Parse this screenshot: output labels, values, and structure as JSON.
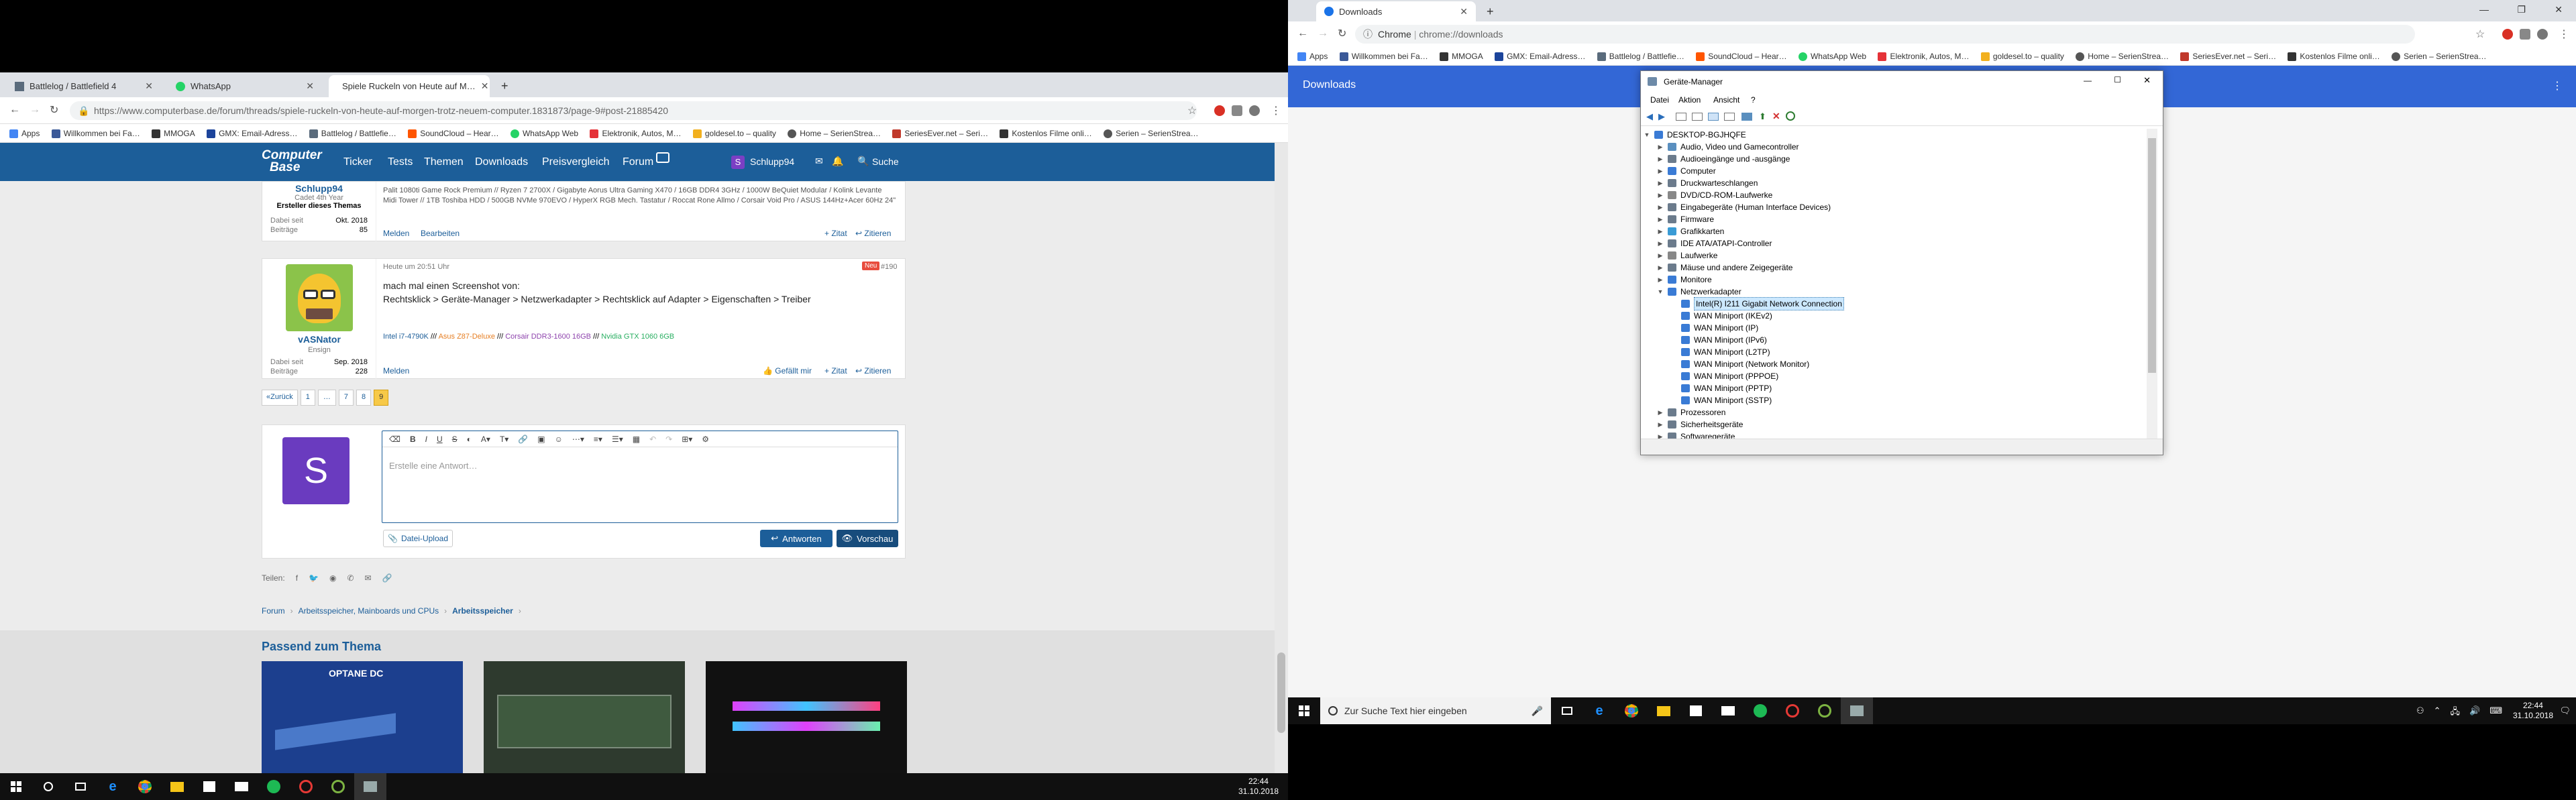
{
  "left_browser": {
    "tabs": [
      {
        "label": "Battlelog / Battlefield 4",
        "color": "#5a6b7c"
      },
      {
        "label": "WhatsApp",
        "color": "#25d366"
      },
      {
        "label": "Spiele Ruckeln von Heute auf M…",
        "color": "#1c5e99"
      }
    ],
    "new_tab": "+",
    "url": "https://www.computerbase.de/forum/threads/spiele-ruckeln-von-heute-auf-morgen-trotz-neuem-computer.1831873/page-9#post-21885420",
    "bookmarks": [
      {
        "label": "Apps",
        "color": "#4285f4"
      },
      {
        "label": "Willkommen bei Fa…",
        "color": "#3b5998"
      },
      {
        "label": "MMOGA",
        "color": "#333333"
      },
      {
        "label": "GMX: Email-Adress…",
        "color": "#1c449b"
      },
      {
        "label": "Battlelog / Battlefie…",
        "color": "#5a6b7c"
      },
      {
        "label": "SoundCloud – Hear…",
        "color": "#ff5500"
      },
      {
        "label": "WhatsApp Web",
        "color": "#25d366"
      },
      {
        "label": "Elektronik, Autos, M…",
        "color": "#e53238"
      },
      {
        "label": "goldesel.to – quality",
        "color": "#f2b01e"
      },
      {
        "label": "Home – SerienStrea…",
        "color": "#555555"
      },
      {
        "label": "SeriesEver.net – Seri…",
        "color": "#c0392b"
      },
      {
        "label": "Kostenlos Filme onli…",
        "color": "#333333"
      },
      {
        "label": "Serien – SerienStrea…",
        "color": "#555555"
      }
    ],
    "site_nav": {
      "logo_line1": "Computer",
      "logo_line2": "Base",
      "items": [
        "Ticker",
        "Tests",
        "Themen",
        "Downloads",
        "Preisvergleich",
        "Forum"
      ],
      "user": "Schlupp94",
      "search": "Suche"
    },
    "post1": {
      "user": "Schlupp94",
      "rank": "Cadet 4th Year",
      "role": "Ersteller dieses Themas",
      "dabei_label": "Dabei seit",
      "dabei": "Okt. 2018",
      "beitraege_label": "Beiträge",
      "beitraege": "85",
      "signature": "Palit 1080ti Game Rock Premium // Ryzen 7 2700X / Gigabyte Aorus Ultra Gaming X470 / 16GB DDR4 3GHz / 1000W BeQuiet Modular / Kolink Levante Midi Tower // 1TB Toshiba HDD / 500GB NVMe 970EVO / HyperX RGB Mech. Tastatur / Roccat Rone Allmo / Corsair Void Pro / ASUS 144Hz+Acer 60Hz 24\"",
      "melden": "Melden",
      "bearbeiten": "Bearbeiten",
      "zitat": "Zitat",
      "zitieren": "Zitieren"
    },
    "post2": {
      "time": "Heute um 20:51 Uhr",
      "badge": "Neu",
      "number": "#190",
      "user": "vASNator",
      "rank": "Ensign",
      "dabei_label": "Dabei seit",
      "dabei": "Sep. 2018",
      "beitraege_label": "Beiträge",
      "beitraege": "228",
      "line1": "mach mal einen Screenshot von:",
      "line2": "Rechtsklick > Geräte-Manager > Netzwerkadapter > Rechtsklick auf Adapter > Eigenschaften > Treiber",
      "sig_parts": [
        {
          "text": "Intel i7-4790K",
          "color": "#1c5e99"
        },
        {
          "text": " /// ",
          "color": "#000000"
        },
        {
          "text": "Asus Z87-Deluxe",
          "color": "#e67e22"
        },
        {
          "text": " /// ",
          "color": "#000000"
        },
        {
          "text": "Corsair DDR3-1600 16GB",
          "color": "#8e44ad"
        },
        {
          "text": " /// ",
          "color": "#000000"
        },
        {
          "text": "Nvidia GTX 1060 6GB",
          "color": "#27ae60"
        }
      ],
      "gefaellt": "Gefällt mir",
      "melden": "Melden",
      "zitat": "Zitat",
      "zitieren": "Zitieren"
    },
    "pagination": [
      "«Zurück",
      "1",
      "…",
      "7",
      "8",
      "9"
    ],
    "editor": {
      "avatar_letter": "S",
      "placeholder": "Erstelle eine Antwort…",
      "upload": "Datei-Upload",
      "antworten": "Antworten",
      "vorschau": "Vorschau"
    },
    "share_label": "Teilen:",
    "breadcrumb": [
      "Forum",
      "Arbeitsspeicher, Mainboards und CPUs",
      "Arbeitsspeicher"
    ],
    "related_title": "Passend zum Thema",
    "related_thumb1_caption": "OPTANE DC",
    "taskbar_time": "22:44",
    "taskbar_date": "31.10.2018"
  },
  "right_browser": {
    "tab": "Downloads",
    "new_tab": "+",
    "omnibox_prefix": "Chrome",
    "omnibox_url": "chrome://downloads",
    "bookmarks": [
      {
        "label": "Apps",
        "color": "#4285f4"
      },
      {
        "label": "Willkommen bei Fa…",
        "color": "#3b5998"
      },
      {
        "label": "MMOGA",
        "color": "#333333"
      },
      {
        "label": "GMX: Email-Adress…",
        "color": "#1c449b"
      },
      {
        "label": "Battlelog / Battlefie…",
        "color": "#5a6b7c"
      },
      {
        "label": "SoundCloud – Hear…",
        "color": "#ff5500"
      },
      {
        "label": "WhatsApp Web",
        "color": "#25d366"
      },
      {
        "label": "Elektronik, Autos, M…",
        "color": "#e53238"
      },
      {
        "label": "goldesel.to – quality",
        "color": "#f2b01e"
      },
      {
        "label": "Home – SerienStrea…",
        "color": "#555555"
      },
      {
        "label": "SeriesEver.net – Seri…",
        "color": "#c0392b"
      },
      {
        "label": "Kostenlos Filme onli…",
        "color": "#333333"
      },
      {
        "label": "Serien – SerienStrea…",
        "color": "#555555"
      }
    ],
    "downloads_title": "Downloads",
    "device_manager": {
      "title": "Geräte-Manager",
      "menu": [
        "Datei",
        "Aktion",
        "Ansicht",
        "?"
      ],
      "nodes": [
        {
          "label": "DESKTOP-BGJHQFE",
          "level": 0,
          "expanded": true,
          "color": "#3a7bd5"
        },
        {
          "label": "Audio, Video und Gamecontroller",
          "level": 1,
          "expanded": false,
          "color": "#5a8fbf"
        },
        {
          "label": "Audioeingänge und -ausgänge",
          "level": 1,
          "expanded": false,
          "color": "#6b7b8c"
        },
        {
          "label": "Computer",
          "level": 1,
          "expanded": false,
          "color": "#3a7bd5"
        },
        {
          "label": "Druckwarteschlangen",
          "level": 1,
          "expanded": false,
          "color": "#6b7b8c"
        },
        {
          "label": "DVD/CD-ROM-Laufwerke",
          "level": 1,
          "expanded": false,
          "color": "#888888"
        },
        {
          "label": "Eingabegeräte (Human Interface Devices)",
          "level": 1,
          "expanded": false,
          "color": "#6b7b8c"
        },
        {
          "label": "Firmware",
          "level": 1,
          "expanded": false,
          "color": "#6b7b8c"
        },
        {
          "label": "Grafikkarten",
          "level": 1,
          "expanded": false,
          "color": "#3a9bd5"
        },
        {
          "label": "IDE ATA/ATAPI-Controller",
          "level": 1,
          "expanded": false,
          "color": "#6b7b8c"
        },
        {
          "label": "Laufwerke",
          "level": 1,
          "expanded": false,
          "color": "#888888"
        },
        {
          "label": "Mäuse und andere Zeigegeräte",
          "level": 1,
          "expanded": false,
          "color": "#6b7b8c"
        },
        {
          "label": "Monitore",
          "level": 1,
          "expanded": false,
          "color": "#3a7bd5"
        },
        {
          "label": "Netzwerkadapter",
          "level": 1,
          "expanded": true,
          "color": "#3a7bd5"
        },
        {
          "label": "Intel(R) I211 Gigabit Network Connection",
          "level": 2,
          "selected": true,
          "color": "#3a7bd5"
        },
        {
          "label": "WAN Miniport (IKEv2)",
          "level": 2,
          "color": "#3a7bd5"
        },
        {
          "label": "WAN Miniport (IP)",
          "level": 2,
          "color": "#3a7bd5"
        },
        {
          "label": "WAN Miniport (IPv6)",
          "level": 2,
          "color": "#3a7bd5"
        },
        {
          "label": "WAN Miniport (L2TP)",
          "level": 2,
          "color": "#3a7bd5"
        },
        {
          "label": "WAN Miniport (Network Monitor)",
          "level": 2,
          "color": "#3a7bd5"
        },
        {
          "label": "WAN Miniport (PPPOE)",
          "level": 2,
          "color": "#3a7bd5"
        },
        {
          "label": "WAN Miniport (PPTP)",
          "level": 2,
          "color": "#3a7bd5"
        },
        {
          "label": "WAN Miniport (SSTP)",
          "level": 2,
          "color": "#3a7bd5"
        },
        {
          "label": "Prozessoren",
          "level": 1,
          "expanded": false,
          "color": "#6b7b8c"
        },
        {
          "label": "Sicherheitsgeräte",
          "level": 1,
          "expanded": false,
          "color": "#6b7b8c"
        },
        {
          "label": "Softwaregeräte",
          "level": 1,
          "expanded": false,
          "color": "#6b7b8c"
        }
      ]
    },
    "search_placeholder": "Zur Suche Text hier eingeben",
    "taskbar_time": "22:44",
    "taskbar_date": "31.10.2018"
  }
}
